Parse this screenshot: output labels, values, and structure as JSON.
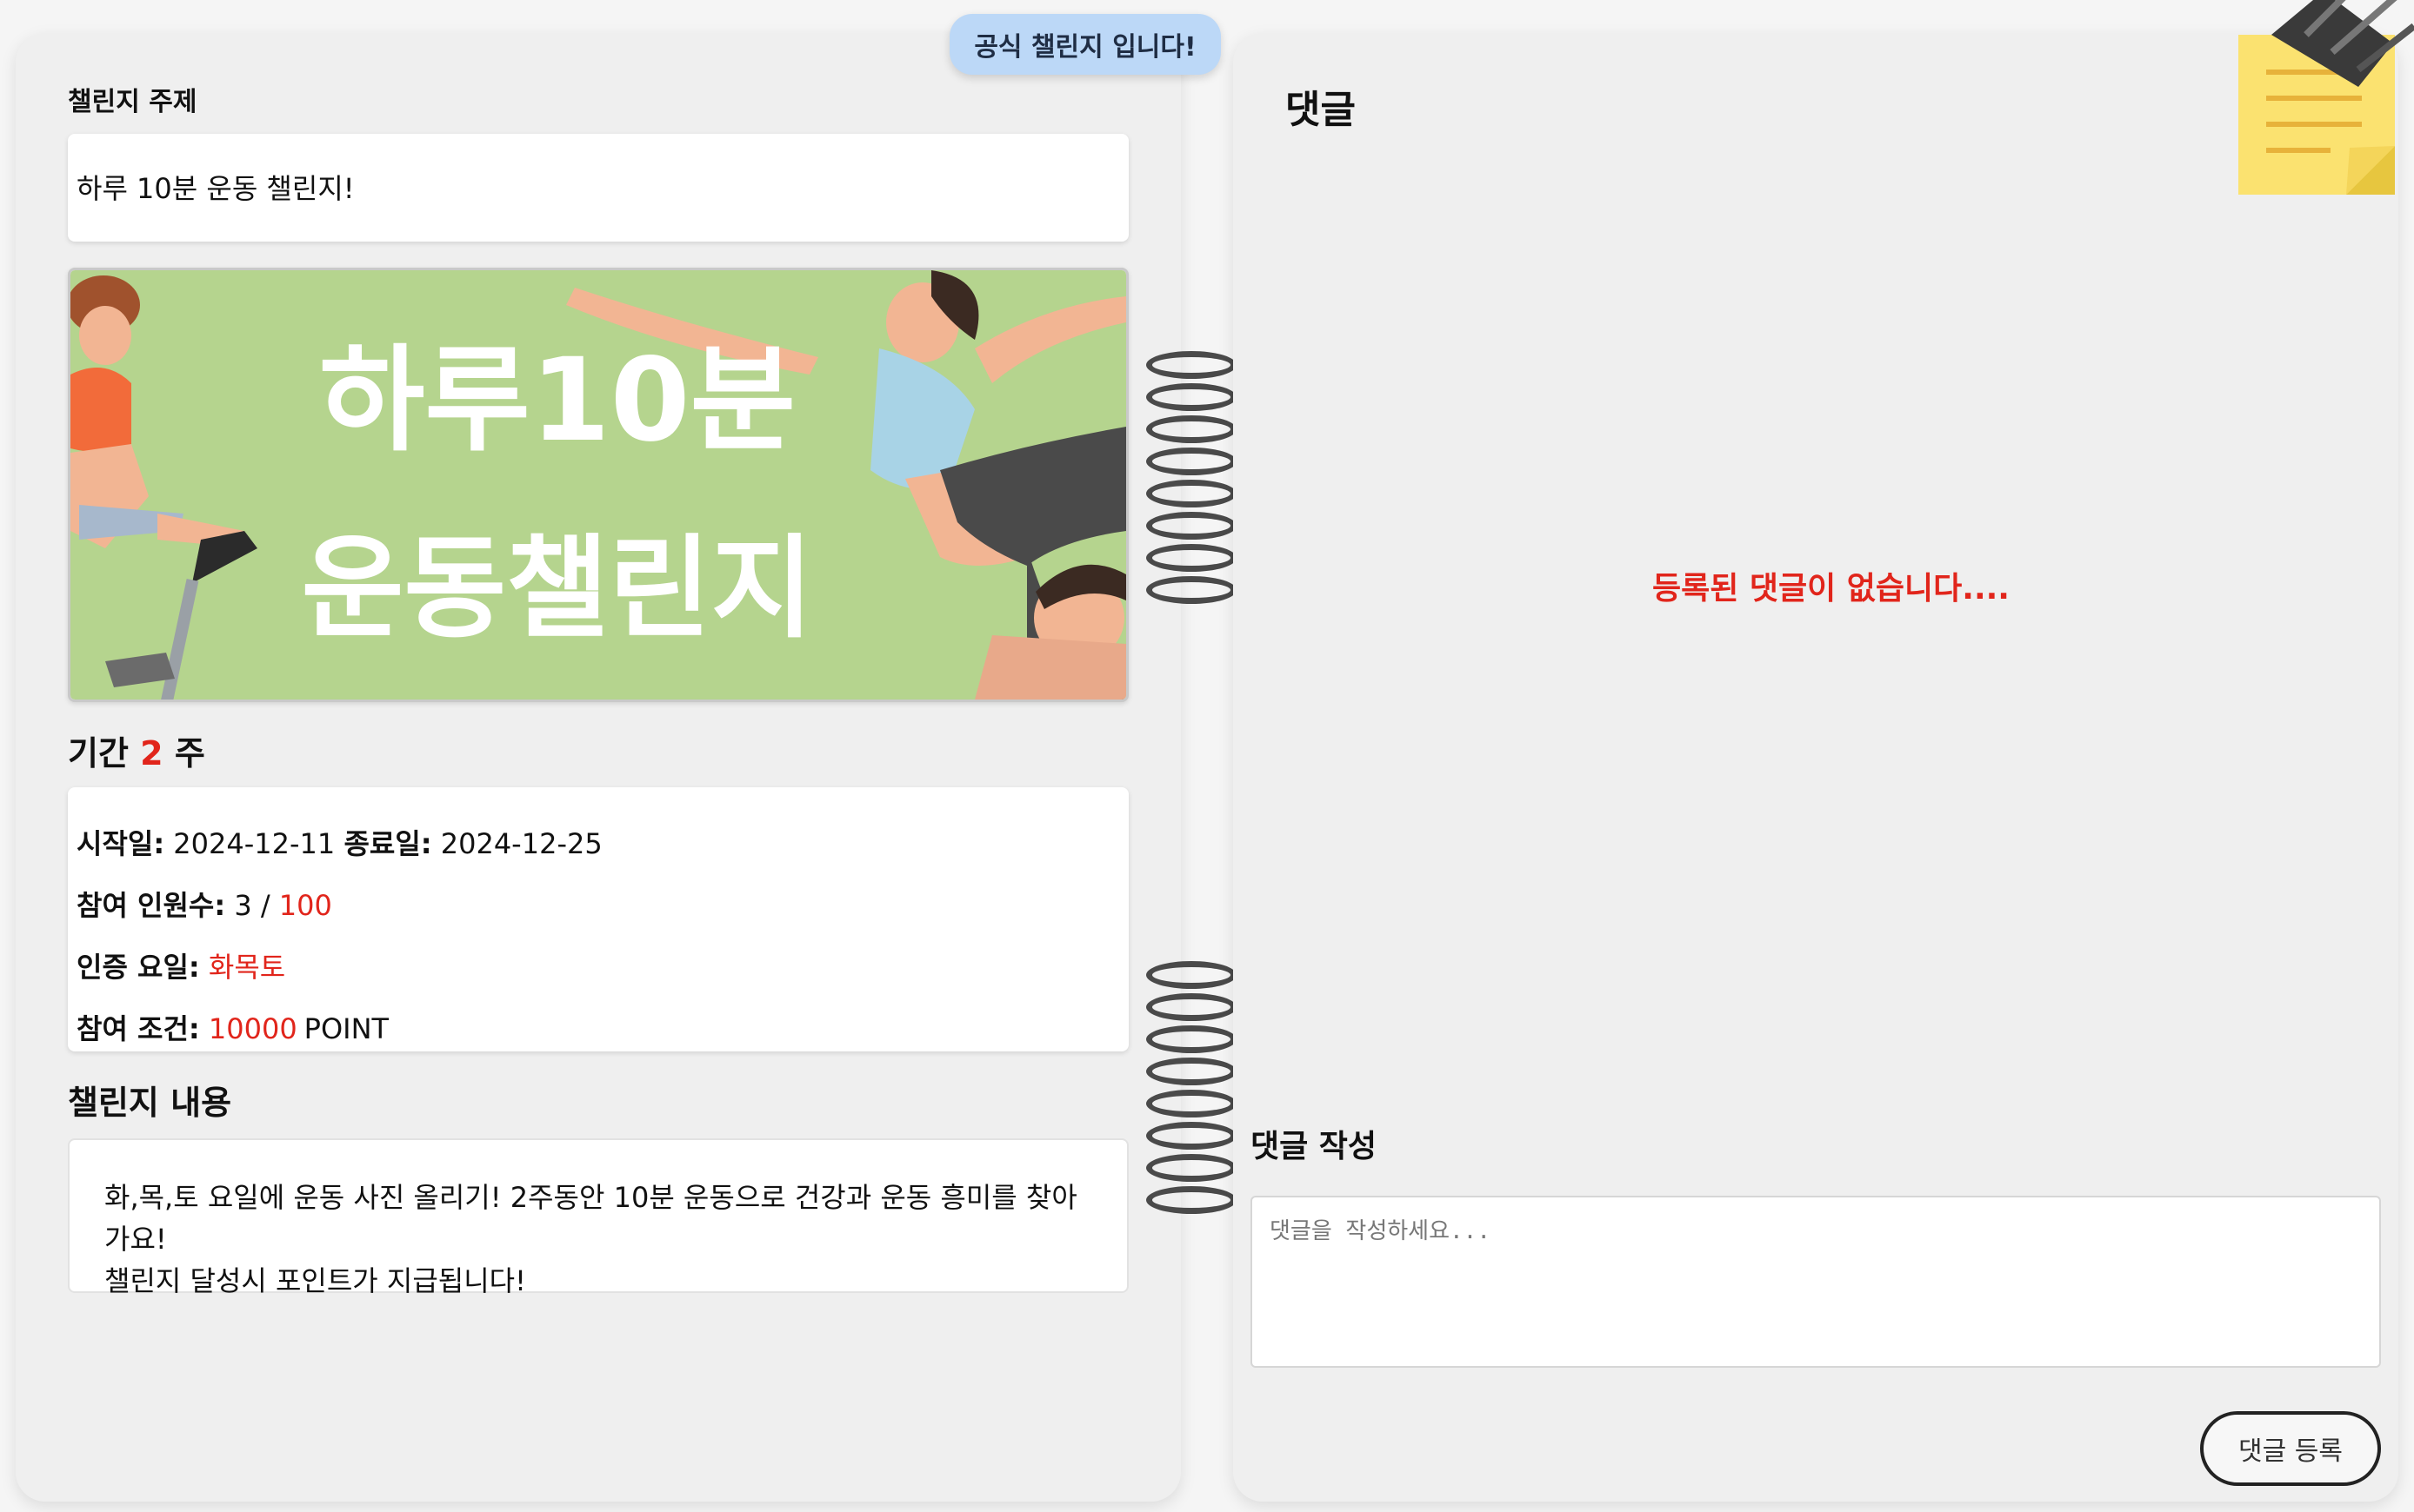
{
  "badge": {
    "official": "공식 챌린지 입니다!"
  },
  "challenge": {
    "topic_label": "챌린지 주제",
    "topic": "하루 10분 운동 챌린지!",
    "banner": {
      "line1": "하루10분",
      "line2": "운동챌린지"
    },
    "duration": {
      "prefix": "기간",
      "weeks": "2",
      "suffix": "주"
    },
    "info": {
      "start_label": "시작일:",
      "start_date": "2024-12-11",
      "end_label": "종료일:",
      "end_date": "2024-12-25",
      "participants_label": "참여 인원수:",
      "participants_current": "3",
      "participants_sep": "/",
      "participants_max": "100",
      "cert_days_label": "인증 요일:",
      "cert_days": "화목토",
      "condition_label": "참여 조건:",
      "condition_points": "10000",
      "condition_unit": "POINT"
    },
    "content_label": "챌린지 내용",
    "content_line1": "화,목,토 요일에 운동 사진 올리기! 2주동안 10분 운동으로 건강과 운동 흥미를 찾아가요!",
    "content_line2": "챌린지 달성시 포인트가 지급됩니다!"
  },
  "comments": {
    "title": "댓글",
    "empty_message": "등록된 댓글이 없습니다....",
    "write_label": "댓글 작성",
    "input_placeholder": "댓글을 작성하세요...",
    "input_value": "",
    "submit_label": "댓글 등록"
  },
  "colors": {
    "accent_red": "#e1251b",
    "badge_blue": "#bcd8f7",
    "banner_green": "#b5d48e",
    "sticky_yellow": "#fbe270"
  },
  "icons": [
    "sticky-note-icon",
    "binder-clip-icon",
    "binder-ring-icon"
  ]
}
